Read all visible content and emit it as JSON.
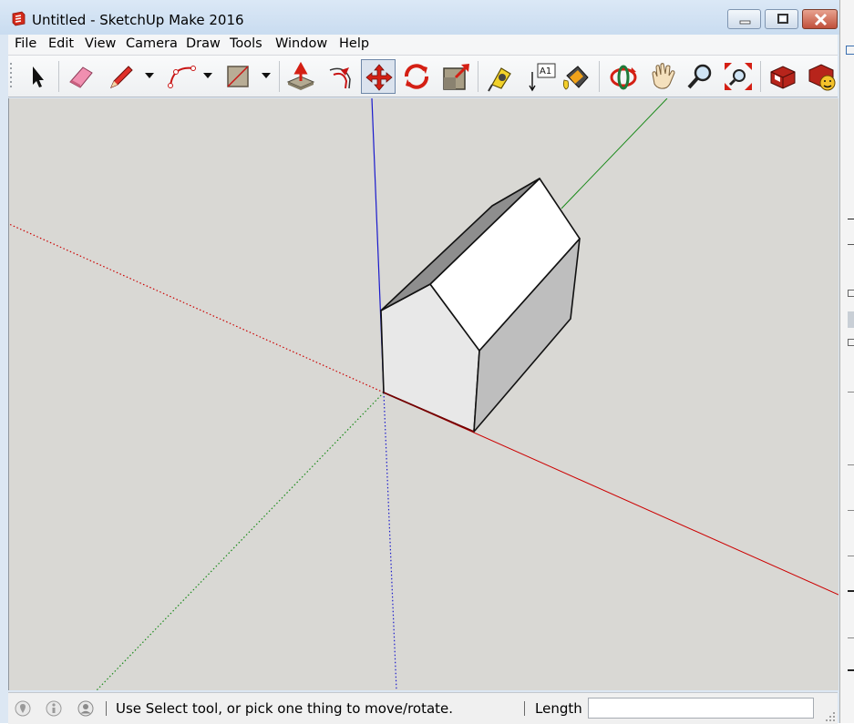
{
  "window": {
    "title": "Untitled - SketchUp Make 2016",
    "app_icon": "sketchup-logo-icon",
    "controls": [
      "minimize-icon",
      "restore-icon",
      "close-icon"
    ]
  },
  "menubar": {
    "items": [
      {
        "label": "File"
      },
      {
        "label": "Edit"
      },
      {
        "label": "View"
      },
      {
        "label": "Camera"
      },
      {
        "label": "Draw"
      },
      {
        "label": "Tools"
      },
      {
        "label": "Window"
      },
      {
        "label": "Help"
      }
    ]
  },
  "toolbar": {
    "tools": [
      {
        "icon": "select-arrow-icon"
      },
      {
        "icon": "eraser-icon"
      },
      {
        "icon": "pencil-line-icon",
        "has_dropdown": true
      },
      {
        "icon": "arc-icon",
        "has_dropdown": true
      },
      {
        "icon": "rectangle-icon",
        "has_dropdown": true
      },
      {
        "icon": "push-pull-icon"
      },
      {
        "icon": "offset-icon"
      },
      {
        "icon": "move-icon",
        "active": true
      },
      {
        "icon": "rotate-icon"
      },
      {
        "icon": "scale-icon"
      },
      {
        "icon": "tape-measure-icon"
      },
      {
        "icon": "text-label-icon",
        "text": "A1"
      },
      {
        "icon": "paint-bucket-icon"
      },
      {
        "icon": "orbit-icon"
      },
      {
        "icon": "pan-hand-icon"
      },
      {
        "icon": "zoom-icon"
      },
      {
        "icon": "zoom-extents-icon"
      },
      {
        "icon": "3d-warehouse-icon"
      },
      {
        "icon": "extension-warehouse-icon"
      }
    ]
  },
  "viewport": {
    "background": "#d9d8d4",
    "axes": {
      "red": "#cc0000",
      "green": "#1a8a1a",
      "blue": "#1a1acc"
    }
  },
  "statusbar": {
    "icons": [
      "geo-location-icon",
      "credits-icon",
      "user-account-icon"
    ],
    "message": "Use Select tool, or pick one thing to move/rotate.",
    "measurement_label": "Length",
    "measurement_value": ""
  }
}
